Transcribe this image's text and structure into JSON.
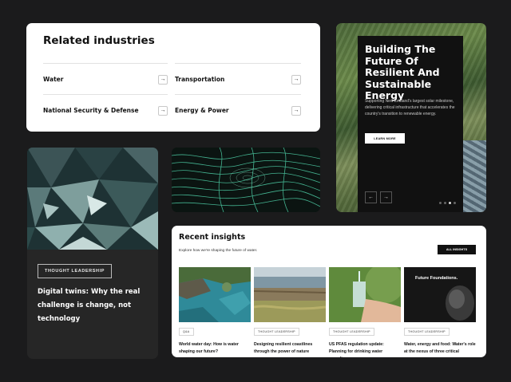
{
  "industries": {
    "title": "Related industries",
    "items": [
      {
        "label": "Water"
      },
      {
        "label": "Transportation"
      },
      {
        "label": "National Security & Defense"
      },
      {
        "label": "Energy & Power"
      }
    ],
    "arrow_glyph": "→"
  },
  "hero": {
    "title": "Building The Future Of Resilient And Sustainable Energy",
    "description": "Supporting New Zealand's largest solar milestone, delivering critical infrastructure that accelerates the country's transition to renewable energy.",
    "cta": "LEARN MORE",
    "prev_glyph": "←",
    "next_glyph": "→",
    "slides": 4,
    "active_slide": 3
  },
  "thought": {
    "tag": "THOUGHT LEADERSHIP",
    "title": "Digital twins: Why the real challenge is change, not technology"
  },
  "insights": {
    "title": "Recent insights",
    "subtitle": "Explore how we're shaping the future of water.",
    "all_button": "ALL INSIGHTS",
    "articles": [
      {
        "tag": "Q&A",
        "title": "World water day: How is water shaping our future?"
      },
      {
        "tag": "THOUGHT LEADERSHIP",
        "title": "Designing resilient coastlines through the power of nature"
      },
      {
        "tag": "THOUGHT LEADERSHIP",
        "title": "US PFAS regulation update: Planning for drinking water compliance"
      },
      {
        "tag": "THOUGHT LEADERSHIP",
        "title": "Water, energy and food: Water's role at the nexus of three critical resources",
        "thumb_caption": "Future Foundations."
      }
    ]
  }
}
